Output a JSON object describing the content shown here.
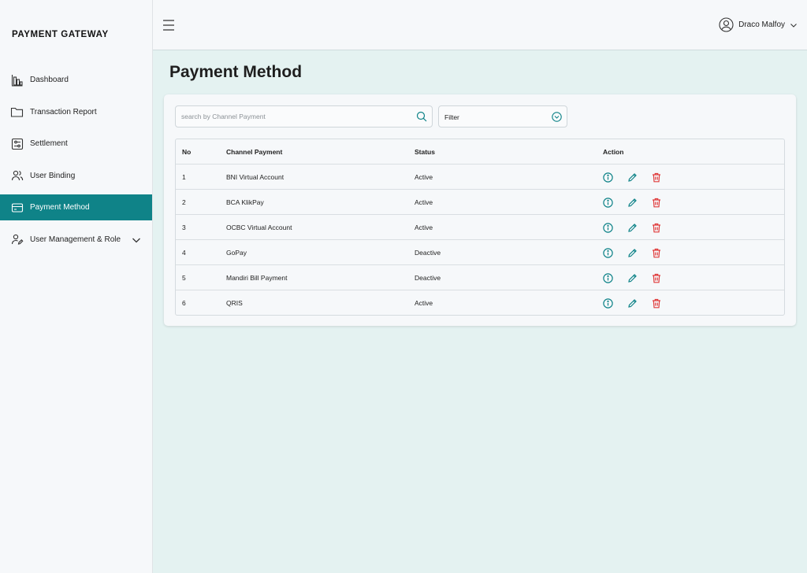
{
  "sidebar": {
    "brand": "PAYMENT GATEWAY",
    "items": [
      {
        "label": "Dashboard",
        "icon": "bar-chart-icon"
      },
      {
        "label": "Transaction Report",
        "icon": "folder-icon"
      },
      {
        "label": "Settlement",
        "icon": "sliders-icon"
      },
      {
        "label": "User Binding",
        "icon": "users-icon"
      },
      {
        "label": "Payment Method",
        "icon": "credit-card-icon",
        "active": true
      },
      {
        "label": "User Management & Role",
        "icon": "user-edit-icon",
        "expandable": true
      }
    ]
  },
  "topbar": {
    "user_name": "Draco Malfoy"
  },
  "page": {
    "title": "Payment Method"
  },
  "search": {
    "placeholder": "search by Channel Payment",
    "value": ""
  },
  "filter": {
    "label": "Filter"
  },
  "table": {
    "columns": [
      "No",
      "Channel Payment",
      "Status",
      "Action"
    ],
    "rows": [
      {
        "no": "1",
        "channel": "BNI Virtual Account",
        "status": "Active"
      },
      {
        "no": "2",
        "channel": "BCA KlikPay",
        "status": "Active"
      },
      {
        "no": "3",
        "channel": "OCBC Virtual Account",
        "status": "Active"
      },
      {
        "no": "4",
        "channel": "GoPay",
        "status": "Deactive"
      },
      {
        "no": "5",
        "channel": "Mandiri Bill Payment",
        "status": "Deactive"
      },
      {
        "no": "6",
        "channel": "QRIS",
        "status": "Active"
      }
    ]
  },
  "colors": {
    "accent": "#0f8388",
    "danger": "#e03b3b",
    "background": "#e4f2f1",
    "surface": "#f6f8fa"
  }
}
